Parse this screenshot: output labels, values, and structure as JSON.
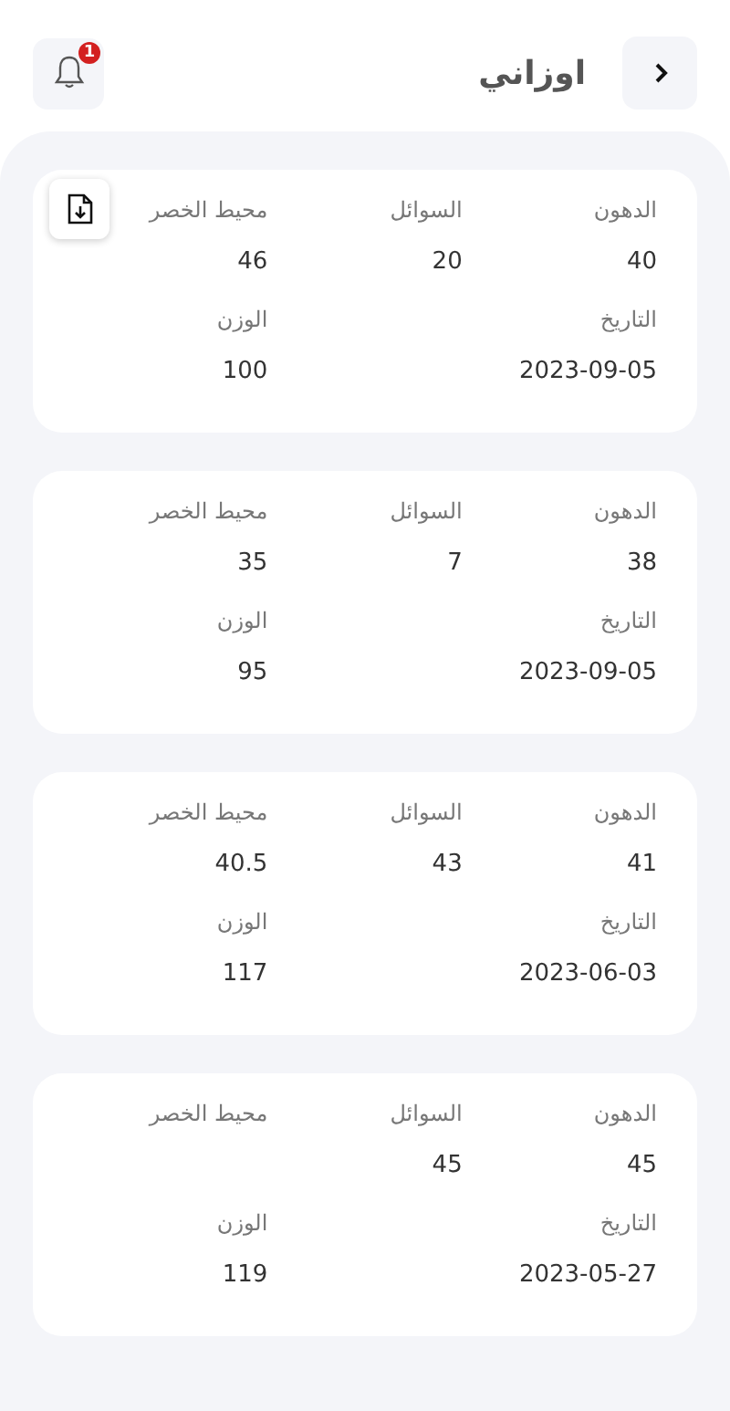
{
  "header": {
    "title": "اوزاني",
    "notification_count": "1"
  },
  "records": [
    {
      "has_download": true,
      "fields": [
        {
          "label": "الدهون",
          "value": "40"
        },
        {
          "label": "السوائل",
          "value": "20"
        },
        {
          "label": "محيط الخصر",
          "value": "46"
        },
        {
          "label": "التاريخ",
          "value": "2023-09-05"
        },
        {
          "label": "الوزن",
          "value": "100"
        }
      ]
    },
    {
      "has_download": false,
      "fields": [
        {
          "label": "الدهون",
          "value": "38"
        },
        {
          "label": "السوائل",
          "value": "7"
        },
        {
          "label": "محيط الخصر",
          "value": "35"
        },
        {
          "label": "التاريخ",
          "value": "2023-09-05"
        },
        {
          "label": "الوزن",
          "value": "95"
        }
      ]
    },
    {
      "has_download": false,
      "fields": [
        {
          "label": "الدهون",
          "value": "41"
        },
        {
          "label": "السوائل",
          "value": "43"
        },
        {
          "label": "محيط الخصر",
          "value": "40.5"
        },
        {
          "label": "التاريخ",
          "value": "2023-06-03"
        },
        {
          "label": "الوزن",
          "value": "117"
        }
      ]
    },
    {
      "has_download": false,
      "fields": [
        {
          "label": "الدهون",
          "value": "45"
        },
        {
          "label": "السوائل",
          "value": "45"
        },
        {
          "label": "محيط الخصر"
        },
        {
          "label": "التاريخ",
          "value": "2023-05-27"
        },
        {
          "label": "الوزن",
          "value": "119"
        }
      ]
    }
  ]
}
